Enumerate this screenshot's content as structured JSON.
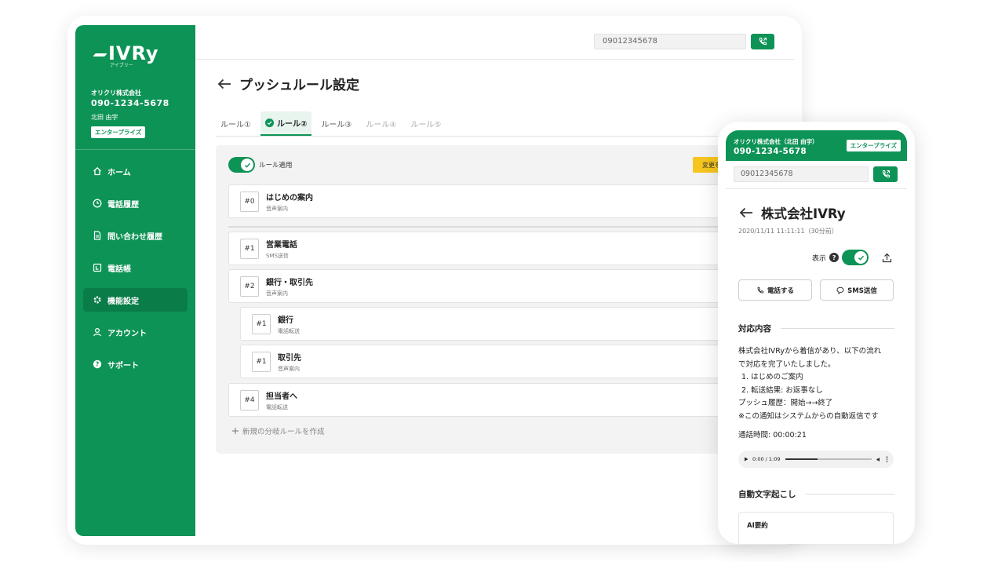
{
  "brand": {
    "logo_text": "IVRy",
    "logo_sub": "アイブリー",
    "accent": "#0e9356",
    "warning": "#f6c51e"
  },
  "sidebar": {
    "company_name": "オリクリ株式会社",
    "company_phone": "090-1234-5678",
    "user_name": "北田 由宇",
    "plan_badge": "エンタープライズ",
    "items": [
      {
        "label": "ホーム",
        "icon": "home-icon"
      },
      {
        "label": "電話履歴",
        "icon": "clock-icon"
      },
      {
        "label": "問い合わせ履歴",
        "icon": "document-icon"
      },
      {
        "label": "電話帳",
        "icon": "phonebook-icon"
      },
      {
        "label": "機能設定",
        "icon": "gear-icon"
      },
      {
        "label": "アカウント",
        "icon": "user-icon"
      },
      {
        "label": "サポート",
        "icon": "help-icon"
      }
    ]
  },
  "topbar": {
    "phone_input_value": "09012345678"
  },
  "page": {
    "title": "プッシュルール設定",
    "tabs": [
      {
        "label": "ルール①"
      },
      {
        "label": "ルール②"
      },
      {
        "label": "ルール③"
      },
      {
        "label": "ルール④"
      },
      {
        "label": "ルール⑤"
      }
    ],
    "toggle_label": "ルール適用",
    "save_button": "変更を",
    "rules": [
      {
        "num": "#0",
        "title": "はじめの案内",
        "sub": "音声案内"
      },
      {
        "num": "#1",
        "title": "営業電話",
        "sub": "SMS送信"
      },
      {
        "num": "#2",
        "title": "銀行・取引先",
        "sub": "音声案内"
      },
      {
        "num": "#1",
        "title": "銀行",
        "sub": "電話転送"
      },
      {
        "num": "#1",
        "title": "取引先",
        "sub": "音声案内"
      },
      {
        "num": "#4",
        "title": "担当者へ",
        "sub": "電話転送"
      }
    ],
    "add_rule": "新規の分岐ルールを作成"
  },
  "phone": {
    "company": "オリクリ株式会社（北田 由宇）",
    "phone": "090-1234-5678",
    "badge": "エンタープライズ",
    "input_value": "09012345678",
    "title": "株式会社IVRy",
    "date": "2020/11/11 11:11:11（30分前）",
    "show_label": "表示",
    "call_button": "電話する",
    "sms_button": "SMS送信",
    "section1": "対応内容",
    "body_lines": [
      "株式会社IVRyから着信があり、以下の流れ",
      "で対応を完了いたしました。",
      "1. はじめのご案内",
      "2. 転送結果: お返事なし",
      "プッシュ履歴：開始→→終了",
      "※この通知はシステムからの自動返信です"
    ],
    "call_time": "通話時間: 00:00:21",
    "audio_time": "0:00 / 1:09",
    "audio_progress": 0.38,
    "section2": "自動文字起こし",
    "ai_label": "AI要約"
  }
}
